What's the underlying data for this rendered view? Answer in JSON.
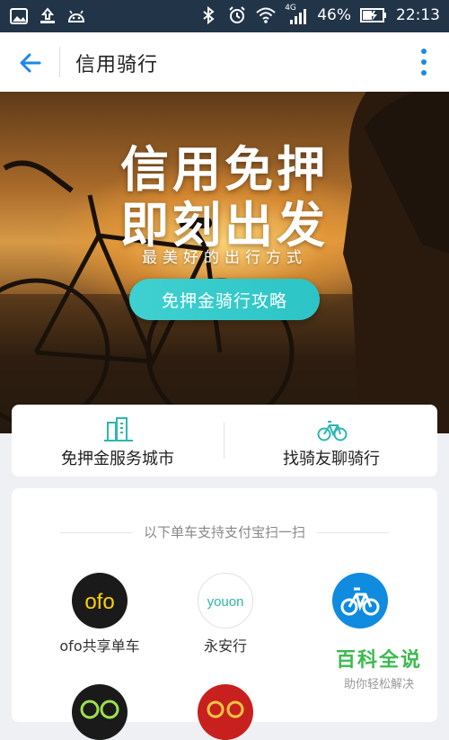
{
  "status_bar": {
    "network": "4G",
    "battery_percent": "46%",
    "time": "22:13"
  },
  "app_bar": {
    "title": "信用骑行"
  },
  "banner": {
    "title_line1": "信用免押",
    "title_line2": "即刻出发",
    "subtitle": "最美好的出行方式",
    "button_label": "免押金骑行攻略"
  },
  "quick_links": [
    {
      "label": "免押金服务城市",
      "icon": "city-buildings-icon"
    },
    {
      "label": "找骑友聊骑行",
      "icon": "bicycle-icon"
    }
  ],
  "bikes_section": {
    "header": "以下单车支持支付宝扫一扫",
    "providers": [
      {
        "name": "ofo共享单车",
        "logo_text": "ofo",
        "logo_color": "#FFD100"
      },
      {
        "name": "永安行",
        "logo_text": "youon",
        "logo_color": "#2BB8A8"
      },
      {
        "name": "",
        "logo_text": "",
        "logo_color": "#0F8BE0"
      }
    ]
  },
  "watermark": {
    "title": "百科全说",
    "subtitle": "助你轻松解决"
  },
  "colors": {
    "status_bar_bg": "#223447",
    "accent_teal": "#2CC4C6",
    "back_arrow": "#1E88E5"
  }
}
